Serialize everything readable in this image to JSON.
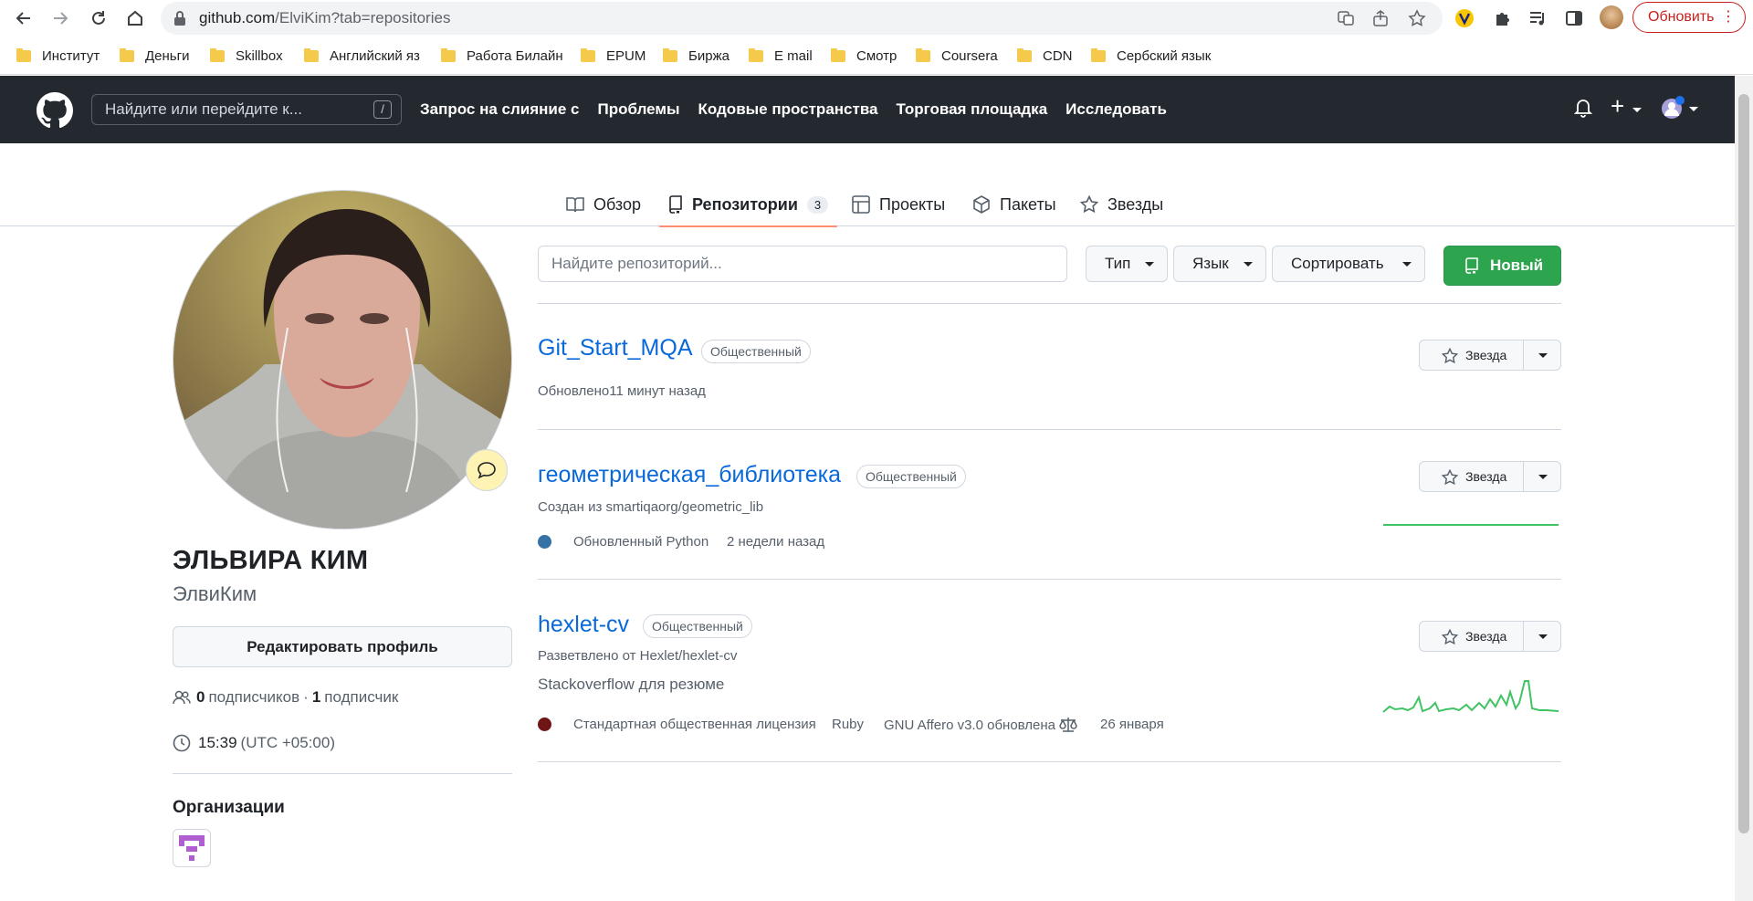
{
  "browser": {
    "url_host": "github.com",
    "url_path": "/ElviKim?tab=repositories",
    "update_label": "Обновить",
    "bookmarks": [
      "Институт",
      "Деньги",
      "Skillbox",
      "Английский яз",
      "Работа Билайн",
      "EPUM",
      "Биржа",
      "E mail",
      "Смотр",
      "Coursera",
      "CDN",
      "Сербский язык"
    ]
  },
  "header": {
    "search_placeholder": "Найдите или перейдите к...",
    "search_shortcut": "/",
    "nav": [
      "Запрос на слияние с",
      "Проблемы",
      "Кодовые пространства",
      "Торговая площадка",
      "Исследовать"
    ],
    "plus_label": "+"
  },
  "tabs": {
    "overview": "Обзор",
    "repositories": "Репозитории",
    "repositories_count": "3",
    "projects": "Проекты",
    "packages": "Пакеты",
    "stars": "Звезды"
  },
  "profile": {
    "full_name": "ЭЛЬВИРА КИМ",
    "username": "ЭлвиКим",
    "edit_label": "Редактировать профиль",
    "followers_count": "0",
    "followers_label": "подписчиков",
    "separator": "·",
    "following_count": "1",
    "following_label": "подписчик",
    "local_time": "15:39",
    "timezone": "(UTC +05:00)",
    "orgs_title": "Организации"
  },
  "repo_toolbar": {
    "search_placeholder": "Найдите репозиторий...",
    "type_label": "Тип",
    "language_label": "Язык",
    "sort_label": "Сортировать",
    "new_label": "Новый"
  },
  "repos": [
    {
      "name": "Git_Start_MQA",
      "visibility": "Общественный",
      "updated": "Обновлено11 минут назад",
      "star_label": "Звезда"
    },
    {
      "name": "геометрическая_библиотека",
      "visibility": "Общественный",
      "source": "Создан из smartiqaorg/geometric_lib",
      "language_updated": "Обновленный Python",
      "updated": "2 недели назад",
      "language_color": "#3572A5",
      "star_label": "Звезда"
    },
    {
      "name": "hexlet-cv",
      "visibility": "Общественный",
      "source": "Разветвлено от Hexlet/hexlet-cv",
      "description": "Stackoverflow для резюме",
      "license_text": "Стандартная общественная лицензия",
      "language": "Ruby",
      "license_updated": "GNU Affero v3.0 обновлена",
      "updated": "26 января",
      "language_color": "#701516",
      "star_label": "Звезда"
    }
  ],
  "colors": {
    "header_bg": "#24292f",
    "link": "#0969da",
    "primary_button": "#2da44e",
    "tab_underline": "#fd8c73",
    "sparkline": "#40c463"
  }
}
